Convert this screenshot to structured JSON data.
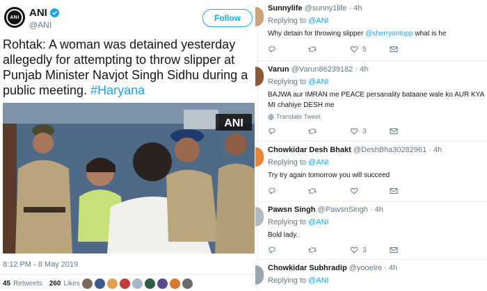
{
  "tweet": {
    "display_name": "ANI",
    "handle": "@ANI",
    "follow_label": "Follow",
    "text": "Rohtak: A woman was detained yesterday allegedly for attempting to throw slipper at Punjab Minister Navjot Singh Sidhu during a public meeting. ",
    "hashtag": "#Haryana",
    "photo_watermark": "ANI",
    "timestamp": "8:12 PM - 8 May 2019",
    "retweets_count": "45",
    "retweets_label": "Retweets",
    "likes_count": "260",
    "likes_label": "Likes",
    "avatar_logo_text": "ANI"
  },
  "replies": [
    {
      "name": "Sunnylife",
      "handle": "@sunny1life",
      "time": "4h",
      "replying_prefix": "Replying to",
      "replying_to": "@ANI",
      "body_text": "Why detain for throwing slipper ",
      "body_mention": "@sherryontopp",
      "body_tail": " what is he",
      "like_count": "5",
      "retweet_count": "",
      "avatar_color": "#c9a27a"
    },
    {
      "name": "Varun",
      "handle": "@Varun86239182",
      "time": "4h",
      "replying_prefix": "Replying to",
      "replying_to": "@ANI",
      "body_text": "BAJWA aur IMRAN me PEACE persanality bataane wale ko AUR KYA MI chahiye DESH me",
      "translate_label": "Translate Tweet",
      "like_count": "3",
      "retweet_count": "",
      "avatar_color": "#8a5a3b"
    },
    {
      "name": "Chowkidar Desh Bhakt",
      "handle": "@DeshBha30282961",
      "time": "4h",
      "replying_prefix": "Replying to",
      "replying_to": "@ANI",
      "body_text": "Try try again tomorrow you will succeed",
      "like_count": "",
      "retweet_count": "",
      "avatar_color": "#e8833a"
    },
    {
      "name": "Pawsn Singh",
      "handle": "@PawsnSingh",
      "time": "4h",
      "replying_prefix": "Replying to",
      "replying_to": "@ANI",
      "body_text": "Bold lady.",
      "like_count": "3",
      "retweet_count": "",
      "avatar_color": "#b0b8c0"
    },
    {
      "name": "Chowkidar Subhradip",
      "handle": "@yooelre",
      "time": "4h",
      "replying_prefix": "Replying to",
      "replying_to": "@ANI",
      "avatar_color": "#9aa5b1"
    }
  ],
  "colors": {
    "accent": "#1da1f2",
    "text": "#14171a",
    "muted": "#657786",
    "divider": "#e6ecf0"
  },
  "icons": [
    "verified-icon",
    "reply-icon",
    "retweet-icon",
    "like-icon",
    "dm-icon",
    "globe-icon"
  ]
}
